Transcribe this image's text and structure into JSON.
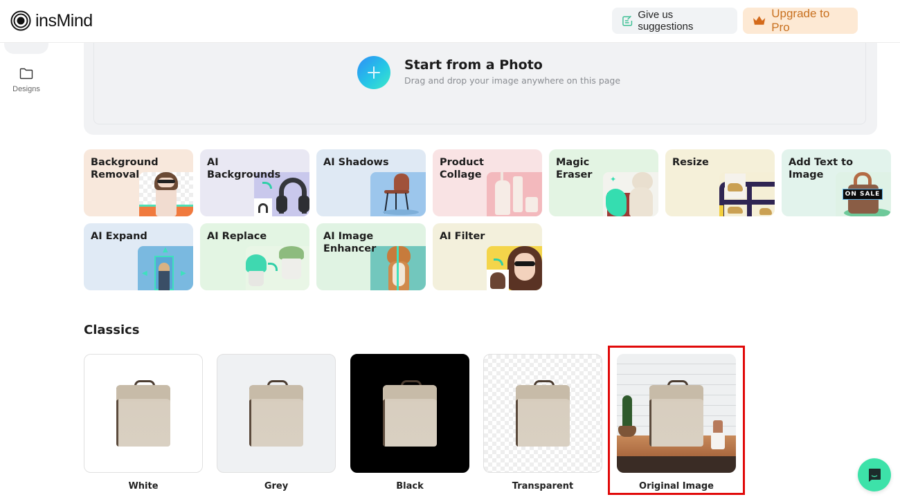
{
  "header": {
    "brand": "insMind",
    "suggest_label": "Give us suggestions",
    "pro_label": "Upgrade to Pro",
    "pro_color": "#c8701f",
    "accent_color": "#3de2a9"
  },
  "sidebar": {
    "items": [
      {
        "label": "Designs",
        "icon": "folder-icon"
      }
    ]
  },
  "upload": {
    "title": "Start from a Photo",
    "subtitle": "Drag and drop your image anywhere on this page",
    "icon": "plus-icon"
  },
  "tools": [
    {
      "label": "Background\nRemoval",
      "bg": "#f8e8dc"
    },
    {
      "label": "AI\nBackgrounds",
      "bg": "#e9e8f3"
    },
    {
      "label": "AI Shadows",
      "bg": "#dfe9f4"
    },
    {
      "label": "Product\nCollage",
      "bg": "#f9e3e4"
    },
    {
      "label": "Magic\nEraser",
      "bg": "#e3f4e3"
    },
    {
      "label": "Resize",
      "bg": "#f5f0d9"
    },
    {
      "label": "Add Text to\nImage",
      "bg": "#e2f3ec",
      "badge": "ON SALE"
    },
    {
      "label": "AI Expand",
      "bg": "#e0eaf5"
    },
    {
      "label": "AI Replace",
      "bg": "#e3f5e3"
    },
    {
      "label": "AI Image\nEnhancer",
      "bg": "#e0f3e3"
    },
    {
      "label": "AI Filter",
      "bg": "#f3f0dc"
    }
  ],
  "classics": {
    "title": "Classics",
    "items": [
      {
        "label": "White",
        "background": "white"
      },
      {
        "label": "Grey",
        "background": "grey"
      },
      {
        "label": "Black",
        "background": "black"
      },
      {
        "label": "Transparent",
        "background": "transparent"
      },
      {
        "label": "Original Image",
        "background": "original",
        "highlighted": true
      }
    ]
  },
  "chat": {
    "icon": "chat-icon"
  }
}
